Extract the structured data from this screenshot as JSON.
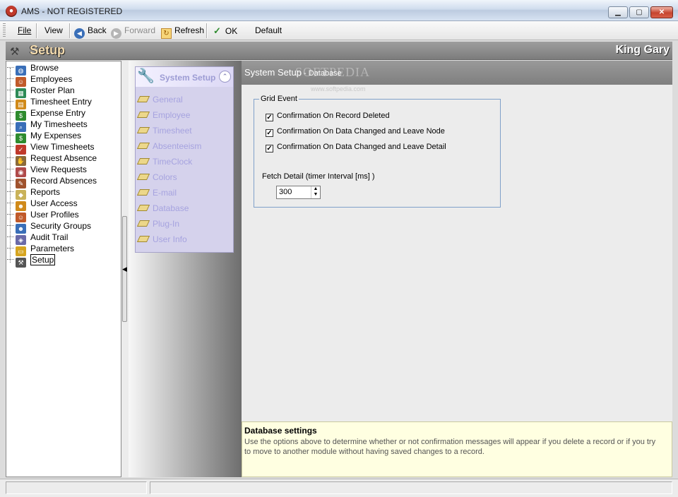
{
  "window": {
    "title": "AMS - NOT REGISTERED",
    "controls": {
      "minimize": "▁",
      "maximize": "▢",
      "close": "✕"
    }
  },
  "toolbar": {
    "file": "File",
    "view": "View",
    "back": "Back",
    "forward": "Forward",
    "refresh": "Refresh",
    "ok": "OK",
    "default": "Default",
    "back_icon_glyph": "◀",
    "forward_icon_glyph": "▶",
    "refresh_icon_glyph": "↻",
    "ok_icon_glyph": "✓"
  },
  "header": {
    "title": "Setup",
    "user": "King Gary",
    "icon_glyph": "⚒"
  },
  "tree": {
    "items": [
      {
        "label": "Browse",
        "icon": "globe-icon",
        "color": "#3a6fb8",
        "glyph": "◍"
      },
      {
        "label": "Employees",
        "icon": "people-icon",
        "color": "#c05a2a",
        "glyph": "☺"
      },
      {
        "label": "Roster Plan",
        "icon": "calendar-icon",
        "color": "#2e8b57",
        "glyph": "▦"
      },
      {
        "label": "Timesheet Entry",
        "icon": "timesheet-icon",
        "color": "#d08a1a",
        "glyph": "▤"
      },
      {
        "label": "Expense Entry",
        "icon": "money-icon",
        "color": "#2e8b2e",
        "glyph": "$"
      },
      {
        "label": "My Timesheets",
        "icon": "magnifier-icon",
        "color": "#3a6fb8",
        "glyph": "⌕"
      },
      {
        "label": "My Expenses",
        "icon": "expenses-icon",
        "color": "#2e8b2e",
        "glyph": "$"
      },
      {
        "label": "View Timesheets",
        "icon": "check-sheet-icon",
        "color": "#c0392b",
        "glyph": "✓"
      },
      {
        "label": "Request Absence",
        "icon": "hand-icon",
        "color": "#8a6a3a",
        "glyph": "✋"
      },
      {
        "label": "View Requests",
        "icon": "eye-icon",
        "color": "#b04a4a",
        "glyph": "◉"
      },
      {
        "label": "Record Absences",
        "icon": "pencil-icon",
        "color": "#a0522d",
        "glyph": "✎"
      },
      {
        "label": "Reports",
        "icon": "report-icon",
        "color": "#c9b25a",
        "glyph": "◆"
      },
      {
        "label": "User Access",
        "icon": "user-key-icon",
        "color": "#d08a1a",
        "glyph": "☻"
      },
      {
        "label": "User Profiles",
        "icon": "profiles-icon",
        "color": "#c05a2a",
        "glyph": "☺"
      },
      {
        "label": "Security Groups",
        "icon": "group-icon",
        "color": "#3a6fb8",
        "glyph": "☻"
      },
      {
        "label": "Audit Trail",
        "icon": "trail-icon",
        "color": "#6a6aa8",
        "glyph": "◈"
      },
      {
        "label": "Parameters",
        "icon": "folder-icon",
        "color": "#d6a520",
        "glyph": "▭"
      },
      {
        "label": "Setup",
        "icon": "tools-icon",
        "color": "#555555",
        "glyph": "⚒"
      }
    ],
    "selected_index": 17
  },
  "system_setup": {
    "title": "System Setup",
    "collapse_glyph": "⌃",
    "wrench_glyph": "🔧",
    "links": [
      "General",
      "Employee",
      "Timesheet",
      "Absenteeism",
      "TimeClock",
      "Colors",
      "E-mail",
      "Database",
      "Plug-In",
      "User Info"
    ]
  },
  "content": {
    "title": "System Setup",
    "subtitle": " - Database",
    "watermark": "SOFTPEDIA",
    "watermark_url": "www.softpedia.com",
    "group_title": "Grid Event",
    "checkboxes": [
      {
        "label": "Confirmation On Record Deleted",
        "checked": true
      },
      {
        "label": "Confirmation On Data Changed and Leave Node",
        "checked": true
      },
      {
        "label": "Confirmation On Data Changed and Leave Detail",
        "checked": true
      }
    ],
    "fetch_label": "Fetch Detail (timer Interval [ms] )",
    "fetch_value": "300",
    "spin_up": "▲",
    "spin_down": "▼"
  },
  "help": {
    "title": "Database settings",
    "text": " Use the options above to determine whether or not confirmation messages will appear if you delete a record or if you try to move to another module without having saved changes to a record."
  },
  "splitter": {
    "arrow": "◀"
  },
  "check_glyph": "✓"
}
